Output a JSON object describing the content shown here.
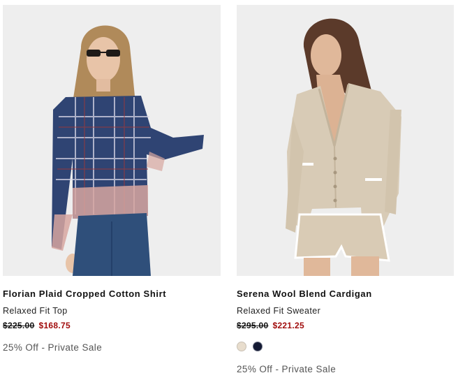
{
  "products": [
    {
      "name": "Florian Plaid Cropped Cotton Shirt",
      "subtitle": "Relaxed Fit Top",
      "original_price": "$225.00",
      "sale_price": "$168.75",
      "promo": "25% Off - Private Sale",
      "image_icon": "model-plaid-shirt-image"
    },
    {
      "name": "Serena Wool Blend Cardigan",
      "subtitle": "Relaxed Fit Sweater",
      "original_price": "$295.00",
      "sale_price": "$221.25",
      "promo": "25% Off - Private Sale",
      "image_icon": "model-cardigan-image",
      "swatches": [
        {
          "color": "#e8ddcd"
        },
        {
          "color": "#141a33"
        }
      ]
    }
  ],
  "colors": {
    "sale_price": "#a10d0d",
    "image_background": "#eeeeee",
    "promo_text": "#555555"
  }
}
